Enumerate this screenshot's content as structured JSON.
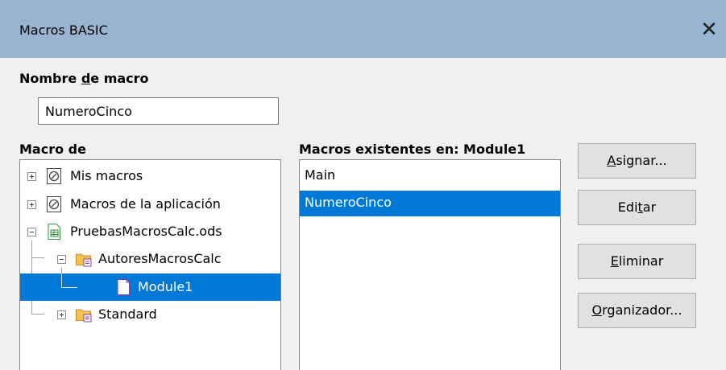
{
  "window": {
    "title": "Macros BASIC",
    "close_symbol": "✕"
  },
  "macro_name": {
    "label_before": "Nombre ",
    "label_mnemonic": "d",
    "label_after": "e macro",
    "value": "NumeroCinco"
  },
  "macro_from": {
    "label": "Macro de",
    "tree": [
      {
        "label": "Mis macros",
        "icon": "macro-library-icon",
        "expander": "plus"
      },
      {
        "label": "Macros de la aplicación",
        "icon": "macro-library-icon",
        "expander": "plus"
      },
      {
        "label": "PruebasMacrosCalc.ods",
        "icon": "spreadsheet-document-icon",
        "expander": "minus"
      },
      {
        "label": "AutoresMacrosCalc",
        "icon": "basic-library-folder-icon",
        "expander": "minus"
      },
      {
        "label": "Module1",
        "icon": "basic-module-icon",
        "selected": true
      },
      {
        "label": "Standard",
        "icon": "basic-library-folder-icon",
        "expander": "plus"
      }
    ]
  },
  "existing_macros": {
    "label": "Macros existentes en: Module1",
    "items": [
      {
        "label": "Main",
        "selected": false
      },
      {
        "label": "NumeroCinco",
        "selected": true
      }
    ]
  },
  "buttons": {
    "assign": {
      "mnemonic": "A",
      "rest": "signar..."
    },
    "edit": {
      "before": "Edi",
      "mnemonic": "t",
      "after": "ar"
    },
    "delete": {
      "mnemonic": "E",
      "rest": "liminar"
    },
    "organizer": {
      "mnemonic": "O",
      "rest": "rganizador..."
    }
  },
  "colors": {
    "titlebar": "#99b4d1",
    "selection": "#0078d7",
    "dialog_bg": "#f0f0f0"
  }
}
